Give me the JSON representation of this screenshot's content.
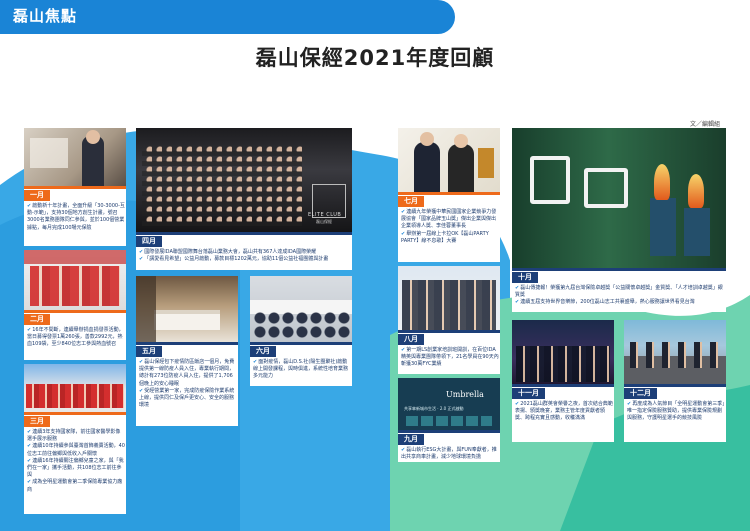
{
  "header": {
    "title": "磊山焦點"
  },
  "page_title": "磊山保經2021年度回顧",
  "credit": "文／編輯組",
  "months": {
    "jan": {
      "label": "一月",
      "items": [
        "啟動新十年計畫，全面升級「30-3000-互動-示範」，支持30個地方創生計畫，號召3000名業務團隊同仁參與，並於100個營業據點，每月完成100場元保險"
      ]
    },
    "feb": {
      "label": "二月",
      "items": [
        "16年不間斷，連續舉辦捐血捐發票活動，當日募得發票1萬260張，善款2992元，熱血109袋，至少840位志工參與熱血號召"
      ]
    },
    "mar": {
      "label": "三月",
      "items": [
        "連續3年支持國家隊，前往國家醫學影像選手展示服務",
        "連續10年持續參與臺灣首飾義賣活動，40位志工前往偏鄉與低收入戶關懷",
        "連續16年持續關注偏鄉兒童之家，與「我們在一家」攜手活動，共108位志工前往參與",
        "成為全明星運動會第二季保險專業協力廠商"
      ]
    },
    "apr": {
      "label": "四月",
      "items": [
        "國際發展IDA聯盟國際舞台落磊山業務大會，磊山共有367人達成IDA國際榮耀",
        "「講愛看見希望」公益月啟動，募款目標1202萬元，協助11個公益社福團體與計畫"
      ]
    },
    "may": {
      "label": "五月",
      "items": [
        "磊山保經包下疫情防區飯店一個月，免費提供第一線防疫人員入住，專業執行期間，總計有273位防疫人員入住，提供了1,706個晚上的安心睡眠",
        "受經營業第一家，完成防疫保險作業系統上線，提供同仁及保戶更安心、安全的服務環境"
      ]
    },
    "jun": {
      "label": "六月",
      "items": [
        "面對疫情，磊山D.S.社(陽生團聚社)啟動線上開發課程，與時俱進，系統性培育業務多元能力"
      ]
    },
    "jul": {
      "label": "七月",
      "items": [
        "連續九年榮獲中華民國國家企業競爭力發展協會「國家品牌玉山獎」傑出企業與傑出企業領導人獎、李佳蓉董事長",
        "舉辦第一屆線上卡拉OK【磊山PARTY PARTY】線不息歌】大賽"
      ]
    },
    "aug": {
      "label": "八月",
      "items": [
        "第一期LS創業家培訓班開訓，在百位IDA精英與專業團隊帶領下，21名學員在90天內斬獲30萬FYC業績"
      ]
    },
    "sep": {
      "label": "九月",
      "items": [
        "磊山執行ESG大計畫，與FUN奉獻者，推出共享商車計畫，減少地球環境負擔"
      ]
    },
    "oct": {
      "label": "十月",
      "items": [
        "磊山傳捷報！榮獲第九屆台灣保險卓越獎「公益關懷卓越獎」金質獎、「人才培訓卓越獎」銀質獎",
        "連續五屆支持世界音樂節，200位磊山志工共襄盛舉，熱心服務讓世界看見台灣"
      ]
    },
    "nov": {
      "label": "十一月",
      "items": [
        "2021磊山群英會榮譽之夜，首次結合典範表揚、頒獎晚宴，業務主管年度貢獻者頒獎、跨程充實且感動，收穫滿滿"
      ]
    },
    "dec": {
      "label": "十二月",
      "items": [
        "再度成為人氣節目「全明星運動會第三季」唯一指定保險服務贊助，提供專業保險規劃與服務，守護明星選手的競技風險"
      ]
    }
  },
  "elite_club": {
    "line1": "ELITE CLUB",
    "line2": "磊山保經"
  },
  "umbrella": {
    "brand": "Umbrella",
    "subtitle": "共享傘新城市生活 · 2.0 正式啟動"
  },
  "colors": {
    "brand_blue": "#1a84d6",
    "month_orange": "#ee6a1b",
    "month_navy": "#1d3f78",
    "text_navy": "#1e3c6e"
  }
}
